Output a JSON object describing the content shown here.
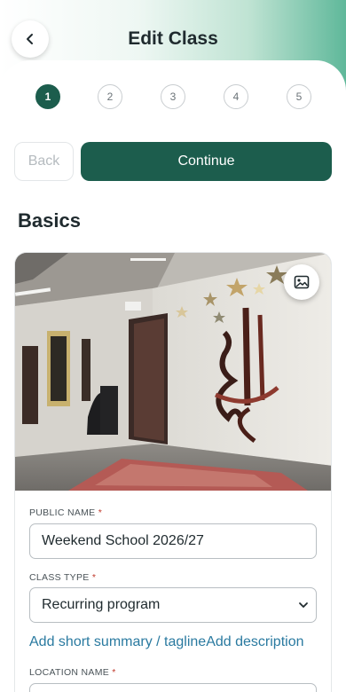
{
  "header": {
    "title": "Edit Class"
  },
  "stepper": {
    "steps": [
      "1",
      "2",
      "3",
      "4",
      "5"
    ],
    "active_step": 1
  },
  "actions": {
    "back_label": "Back",
    "continue_label": "Continue"
  },
  "section": {
    "title": "Basics"
  },
  "form": {
    "public_name": {
      "label": "PUBLIC NAME",
      "required_mark": "*",
      "value": "Weekend School 2026/27"
    },
    "class_type": {
      "label": "CLASS TYPE",
      "required_mark": "*",
      "selected": "Recurring program"
    },
    "links": {
      "summary": "Add short summary / tagline",
      "description": "Add description"
    },
    "location_name": {
      "label": "LOCATION NAME",
      "required_mark": "*",
      "value": ""
    }
  },
  "icons": {
    "back": "chevron-left-icon",
    "image": "image-icon",
    "select": "chevron-down-icon"
  },
  "colors": {
    "primary": "#1c5d4d",
    "link": "#2a7aa0",
    "required": "#c0392b"
  }
}
